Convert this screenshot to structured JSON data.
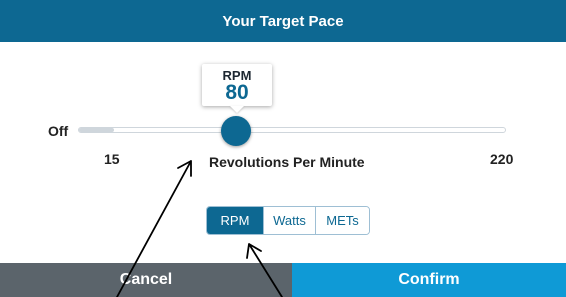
{
  "header": {
    "title": "Your Target Pace"
  },
  "slider": {
    "tooltip_unit": "RPM",
    "tooltip_value": "80",
    "off_label": "Off",
    "min_label": "15",
    "max_label": "220",
    "caption": "Revolutions Per Minute",
    "value": 80,
    "min": 15,
    "max": 220
  },
  "unit_toggle": {
    "options": [
      "RPM",
      "Watts",
      "METs"
    ],
    "selected": "RPM"
  },
  "footer": {
    "cancel_label": "Cancel",
    "confirm_label": "Confirm"
  },
  "colors": {
    "header_bg": "#0d6892",
    "accent": "#0d6892",
    "cancel_bg": "#5b646b",
    "confirm_bg": "#0f9ad6"
  }
}
